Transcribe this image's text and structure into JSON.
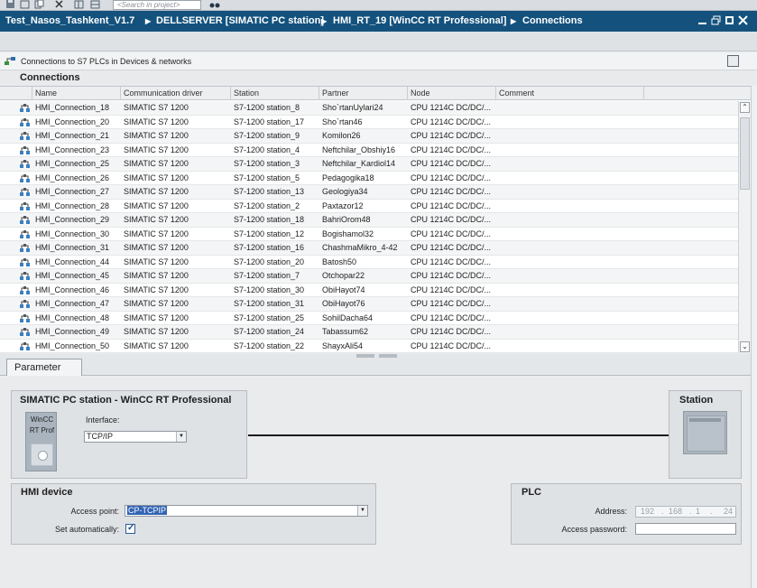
{
  "toolbar": {
    "search_placeholder": "<Search in project>"
  },
  "breadcrumb": {
    "items": [
      "Test_Nasos_Tashkent_V1.7",
      "DELLSERVER [SIMATIC PC station]",
      "HMI_RT_19 [WinCC RT Professional]",
      "Connections"
    ],
    "separator": "▶"
  },
  "editor": {
    "header_label": "Connections to S7 PLCs in Devices & networks",
    "section_title": "Connections"
  },
  "table": {
    "columns": [
      "Name",
      "Communication driver",
      "Station",
      "Partner",
      "Node",
      "Comment"
    ],
    "rows": [
      [
        "HMI_Connection_18",
        "SIMATIC S7 1200",
        "S7-1200 station_8",
        "Sho`rtanUylari24",
        "CPU 1214C DC/DC/..."
      ],
      [
        "HMI_Connection_20",
        "SIMATIC S7 1200",
        "S7-1200 station_17",
        "Sho`rtan46",
        "CPU 1214C DC/DC/..."
      ],
      [
        "HMI_Connection_21",
        "SIMATIC S7 1200",
        "S7-1200 station_9",
        "Komilon26",
        "CPU 1214C DC/DC/..."
      ],
      [
        "HMI_Connection_23",
        "SIMATIC S7 1200",
        "S7-1200 station_4",
        "Neftchilar_Obshiy16",
        "CPU 1214C DC/DC/..."
      ],
      [
        "HMI_Connection_25",
        "SIMATIC S7 1200",
        "S7-1200 station_3",
        "Neftchilar_Kardiol14",
        "CPU 1214C DC/DC/..."
      ],
      [
        "HMI_Connection_26",
        "SIMATIC S7 1200",
        "S7-1200 station_5",
        "Pedagogika18",
        "CPU 1214C DC/DC/..."
      ],
      [
        "HMI_Connection_27",
        "SIMATIC S7 1200",
        "S7-1200 station_13",
        "Geologiya34",
        "CPU 1214C DC/DC/..."
      ],
      [
        "HMI_Connection_28",
        "SIMATIC S7 1200",
        "S7-1200 station_2",
        "Paxtazor12",
        "CPU 1214C DC/DC/..."
      ],
      [
        "HMI_Connection_29",
        "SIMATIC S7 1200",
        "S7-1200 station_18",
        "BahriOrom48",
        "CPU 1214C DC/DC/..."
      ],
      [
        "HMI_Connection_30",
        "SIMATIC S7 1200",
        "S7-1200 station_12",
        "Bogishamol32",
        "CPU 1214C DC/DC/..."
      ],
      [
        "HMI_Connection_31",
        "SIMATIC S7 1200",
        "S7-1200 station_16",
        "ChashmaMikro_4-42",
        "CPU 1214C DC/DC/..."
      ],
      [
        "HMI_Connection_44",
        "SIMATIC S7 1200",
        "S7-1200 station_20",
        "Batosh50",
        "CPU 1214C DC/DC/..."
      ],
      [
        "HMI_Connection_45",
        "SIMATIC S7 1200",
        "S7-1200 station_7",
        "Otchopar22",
        "CPU 1214C DC/DC/..."
      ],
      [
        "HMI_Connection_46",
        "SIMATIC S7 1200",
        "S7-1200 station_30",
        "ObiHayot74",
        "CPU 1214C DC/DC/..."
      ],
      [
        "HMI_Connection_47",
        "SIMATIC S7 1200",
        "S7-1200 station_31",
        "ObiHayot76",
        "CPU 1214C DC/DC/..."
      ],
      [
        "HMI_Connection_48",
        "SIMATIC S7 1200",
        "S7-1200 station_25",
        "SohilDacha64",
        "CPU 1214C DC/DC/..."
      ],
      [
        "HMI_Connection_49",
        "SIMATIC S7 1200",
        "S7-1200 station_24",
        "Tabassum62",
        "CPU 1214C DC/DC/..."
      ],
      [
        "HMI_Connection_50",
        "SIMATIC S7 1200",
        "S7-1200 station_22",
        "ShayxAli54",
        "CPU 1214C DC/DC/..."
      ]
    ]
  },
  "parameter": {
    "tab_label": "Parameter",
    "pc_panel_title": "SIMATIC PC station - WinCC RT Professional",
    "wincc_label_1": "WinCC",
    "wincc_label_2": "RT Prof",
    "interface_label": "Interface:",
    "interface_value": "TCP/IP",
    "station_title": "Station",
    "hmi_title": "HMI device",
    "access_point_label": "Access point:",
    "access_point_value": "CP-TCPIP",
    "set_auto_label": "Set automatically:",
    "set_auto_checked": true,
    "plc_title": "PLC",
    "address_label": "Address:",
    "address_octets": [
      "192",
      "168",
      "1",
      "24"
    ],
    "address_dots": ".",
    "access_password_label": "Access password:"
  },
  "icons": [
    "plc-connection-icon",
    "dropdown-arrow-icon",
    "checkmark-icon",
    "scroll-up-icon",
    "scroll-down-icon"
  ],
  "colors": {
    "title_bar": "#14527d",
    "selection": "#3264b4"
  }
}
